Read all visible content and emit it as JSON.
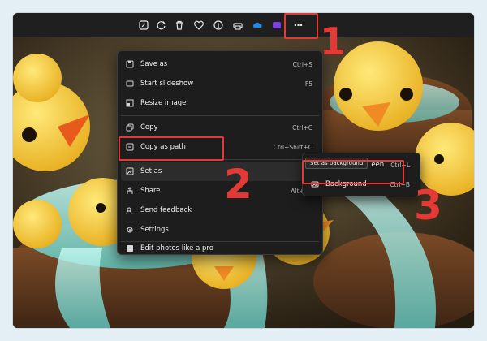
{
  "toolbar": {
    "buttons": [
      {
        "icon": "edit-icon"
      },
      {
        "icon": "rotate-icon"
      },
      {
        "icon": "delete-icon"
      },
      {
        "icon": "heart-icon"
      },
      {
        "icon": "info-icon"
      },
      {
        "icon": "print-icon"
      },
      {
        "icon": "onedrive-icon"
      },
      {
        "icon": "clipchamp-icon"
      },
      {
        "icon": "more-icon",
        "label": "···"
      }
    ]
  },
  "menu": {
    "items": [
      {
        "label": "Save as",
        "shortcut": "Ctrl+S",
        "icon": "save-icon"
      },
      {
        "label": "Start slideshow",
        "shortcut": "F5",
        "icon": "slideshow-icon"
      },
      {
        "label": "Resize image",
        "shortcut": "",
        "icon": "resize-icon"
      },
      {
        "label": "Copy",
        "shortcut": "Ctrl+C",
        "icon": "copy-icon"
      },
      {
        "label": "Copy as path",
        "shortcut": "Ctrl+Shift+C",
        "icon": "copy-path-icon"
      },
      {
        "label": "Set as",
        "shortcut": "",
        "icon": "set-as-icon"
      },
      {
        "label": "Share",
        "shortcut": "Alt+Up",
        "icon": "share-icon"
      },
      {
        "label": "Send feedback",
        "shortcut": "",
        "icon": "feedback-icon"
      },
      {
        "label": "Settings",
        "shortcut": "",
        "icon": "settings-icon"
      },
      {
        "label": "Edit photos like a pro",
        "shortcut": "",
        "icon": "pro-edit-icon"
      }
    ]
  },
  "submenu": {
    "items": [
      {
        "label": "een",
        "shortcut": "Ctrl+L"
      },
      {
        "label": "Background",
        "shortcut": "Ctrl+B",
        "icon": "wallpaper-icon"
      }
    ],
    "tooltip": "Set as background"
  },
  "annotations": {
    "step1": "1",
    "step2": "2",
    "step3": "3"
  },
  "colors": {
    "highlight": "#e53935",
    "menu_bg": "#1d1d1d",
    "toolbar_bg": "#1f1f1f"
  }
}
